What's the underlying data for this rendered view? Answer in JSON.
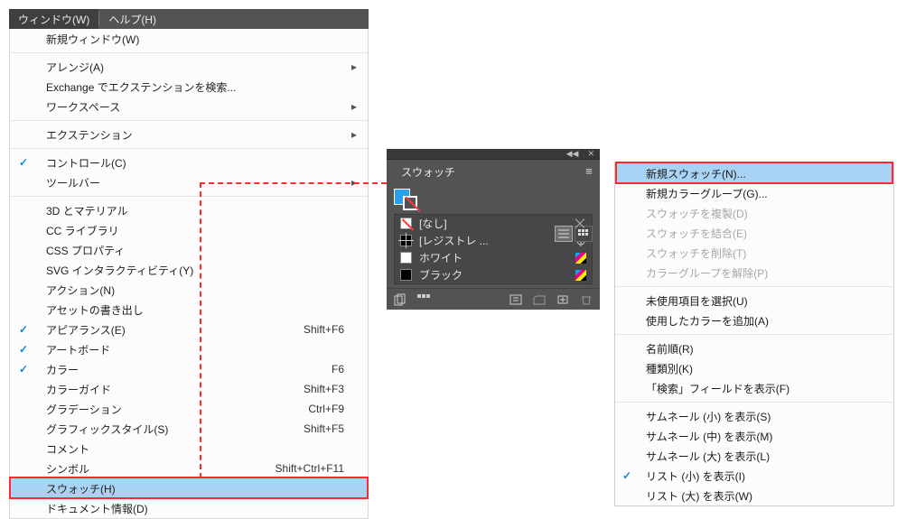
{
  "topbar": {
    "window_label": "ウィンドウ(W)",
    "help_label": "ヘルプ(H)"
  },
  "menu": [
    {
      "type": "item",
      "label": "新規ウィンドウ(W)"
    },
    {
      "type": "sep"
    },
    {
      "type": "item",
      "label": "アレンジ(A)",
      "submenu": true
    },
    {
      "type": "item",
      "label": "Exchange でエクステンションを検索..."
    },
    {
      "type": "item",
      "label": "ワークスペース",
      "submenu": true
    },
    {
      "type": "sep"
    },
    {
      "type": "item",
      "label": "エクステンション",
      "submenu": true
    },
    {
      "type": "sep"
    },
    {
      "type": "item",
      "label": "コントロール(C)",
      "checked": true
    },
    {
      "type": "item",
      "label": "ツールバー",
      "submenu": true
    },
    {
      "type": "sep"
    },
    {
      "type": "item",
      "label": "3D とマテリアル"
    },
    {
      "type": "item",
      "label": "CC ライブラリ"
    },
    {
      "type": "item",
      "label": "CSS プロパティ"
    },
    {
      "type": "item",
      "label": "SVG インタラクティビティ(Y)"
    },
    {
      "type": "item",
      "label": "アクション(N)"
    },
    {
      "type": "item",
      "label": "アセットの書き出し"
    },
    {
      "type": "item",
      "label": "アピアランス(E)",
      "checked": true,
      "shortcut": "Shift+F6"
    },
    {
      "type": "item",
      "label": "アートボード",
      "checked": true
    },
    {
      "type": "item",
      "label": "カラー",
      "checked": true,
      "shortcut": "F6"
    },
    {
      "type": "item",
      "label": "カラーガイド",
      "shortcut": "Shift+F3"
    },
    {
      "type": "item",
      "label": "グラデーション",
      "shortcut": "Ctrl+F9"
    },
    {
      "type": "item",
      "label": "グラフィックスタイル(S)",
      "shortcut": "Shift+F5"
    },
    {
      "type": "item",
      "label": "コメント"
    },
    {
      "type": "item",
      "label": "シンボル",
      "shortcut": "Shift+Ctrl+F11"
    },
    {
      "type": "item",
      "label": "スウォッチ(H)",
      "highlight": true
    },
    {
      "type": "item",
      "label": "ドキュメント情報(D)"
    }
  ],
  "panel": {
    "tab_label": "スウォッチ",
    "rows": [
      {
        "kind": "none",
        "label": "[なし]",
        "ind": "none"
      },
      {
        "kind": "reg",
        "label": "[レジストレ ...",
        "ind": "reg"
      },
      {
        "kind": "white",
        "label": "ホワイト",
        "ind": "cmyk"
      },
      {
        "kind": "black",
        "label": "ブラック",
        "ind": "cmyk"
      }
    ]
  },
  "flyout": [
    {
      "type": "item",
      "label": "新規スウォッチ(N)...",
      "highlight": true
    },
    {
      "type": "item",
      "label": "新規カラーグループ(G)..."
    },
    {
      "type": "item",
      "label": "スウォッチを複製(D)",
      "disabled": true
    },
    {
      "type": "item",
      "label": "スウォッチを結合(E)",
      "disabled": true
    },
    {
      "type": "item",
      "label": "スウォッチを削除(T)",
      "disabled": true
    },
    {
      "type": "item",
      "label": "カラーグループを解除(P)",
      "disabled": true
    },
    {
      "type": "sep"
    },
    {
      "type": "item",
      "label": "未使用項目を選択(U)"
    },
    {
      "type": "item",
      "label": "使用したカラーを追加(A)"
    },
    {
      "type": "sep"
    },
    {
      "type": "item",
      "label": "名前順(R)"
    },
    {
      "type": "item",
      "label": "種類別(K)"
    },
    {
      "type": "item",
      "label": "「検索」フィールドを表示(F)"
    },
    {
      "type": "sep"
    },
    {
      "type": "item",
      "label": "サムネール (小) を表示(S)"
    },
    {
      "type": "item",
      "label": "サムネール (中) を表示(M)"
    },
    {
      "type": "item",
      "label": "サムネール (大) を表示(L)"
    },
    {
      "type": "item",
      "label": "リスト (小) を表示(I)",
      "checked": true
    },
    {
      "type": "item",
      "label": "リスト (大) を表示(W)"
    }
  ]
}
